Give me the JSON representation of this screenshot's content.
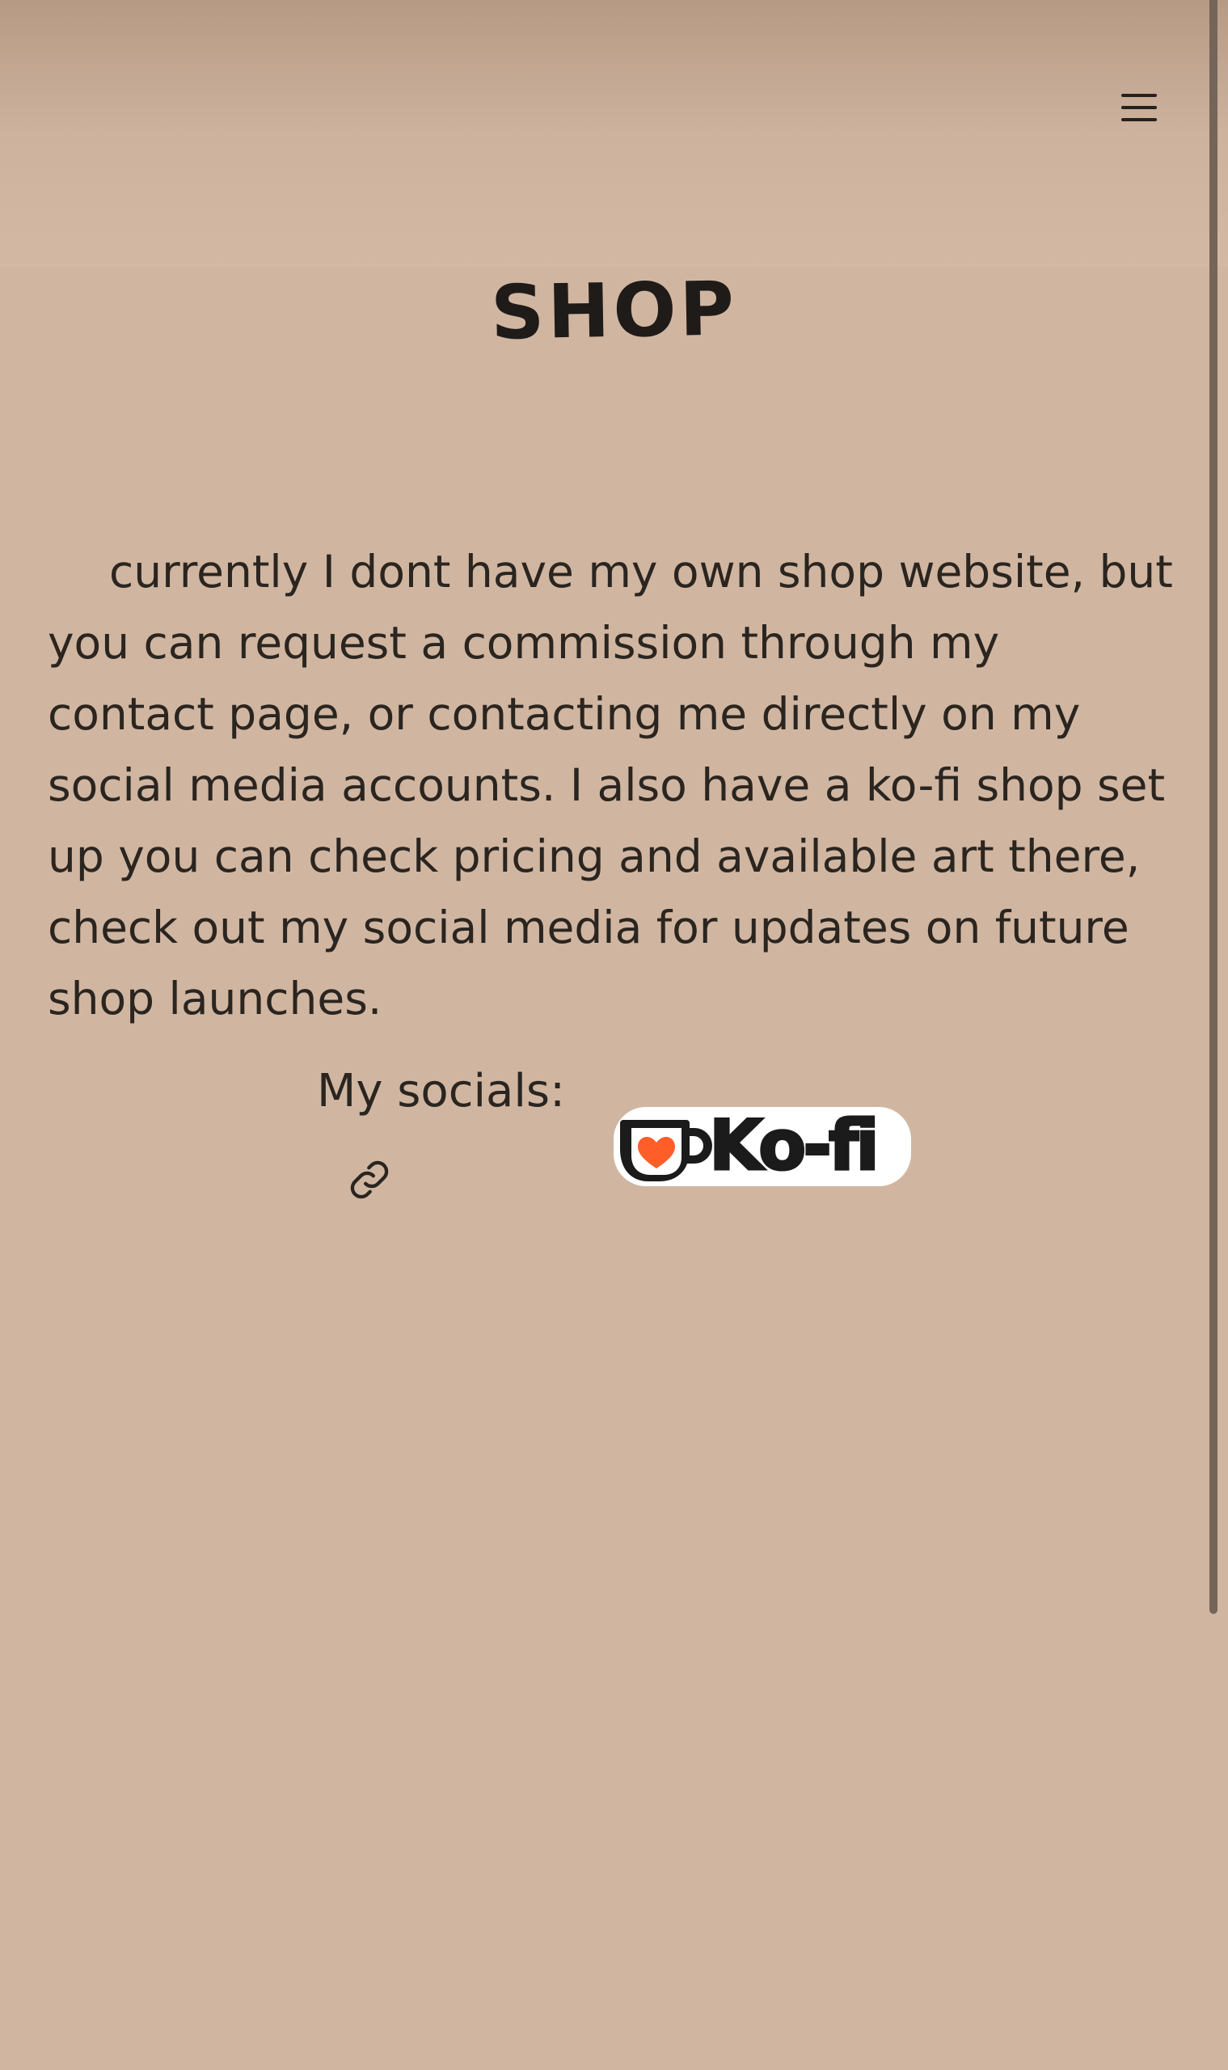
{
  "page": {
    "title": "SHOP",
    "background_color": "#d0b6a1",
    "header_gradient_top": "#b69a84"
  },
  "header": {
    "menu_icon": "hamburger-menu-icon"
  },
  "content": {
    "intro_text": "currently I dont have my own shop website, but you can request a commission through my contact page, or contacting me directly on my social media accounts. I also have a ko-fi shop set up you can check pricing and available art there, check out my social media for updates on future shop launches.",
    "socials_label": "My socials:",
    "socials_link_icon": "link-icon"
  },
  "kofi": {
    "brand_text": "Ko-fi",
    "cup_icon": "coffee-cup-heart-icon",
    "accent_color": "#ff5e29"
  }
}
